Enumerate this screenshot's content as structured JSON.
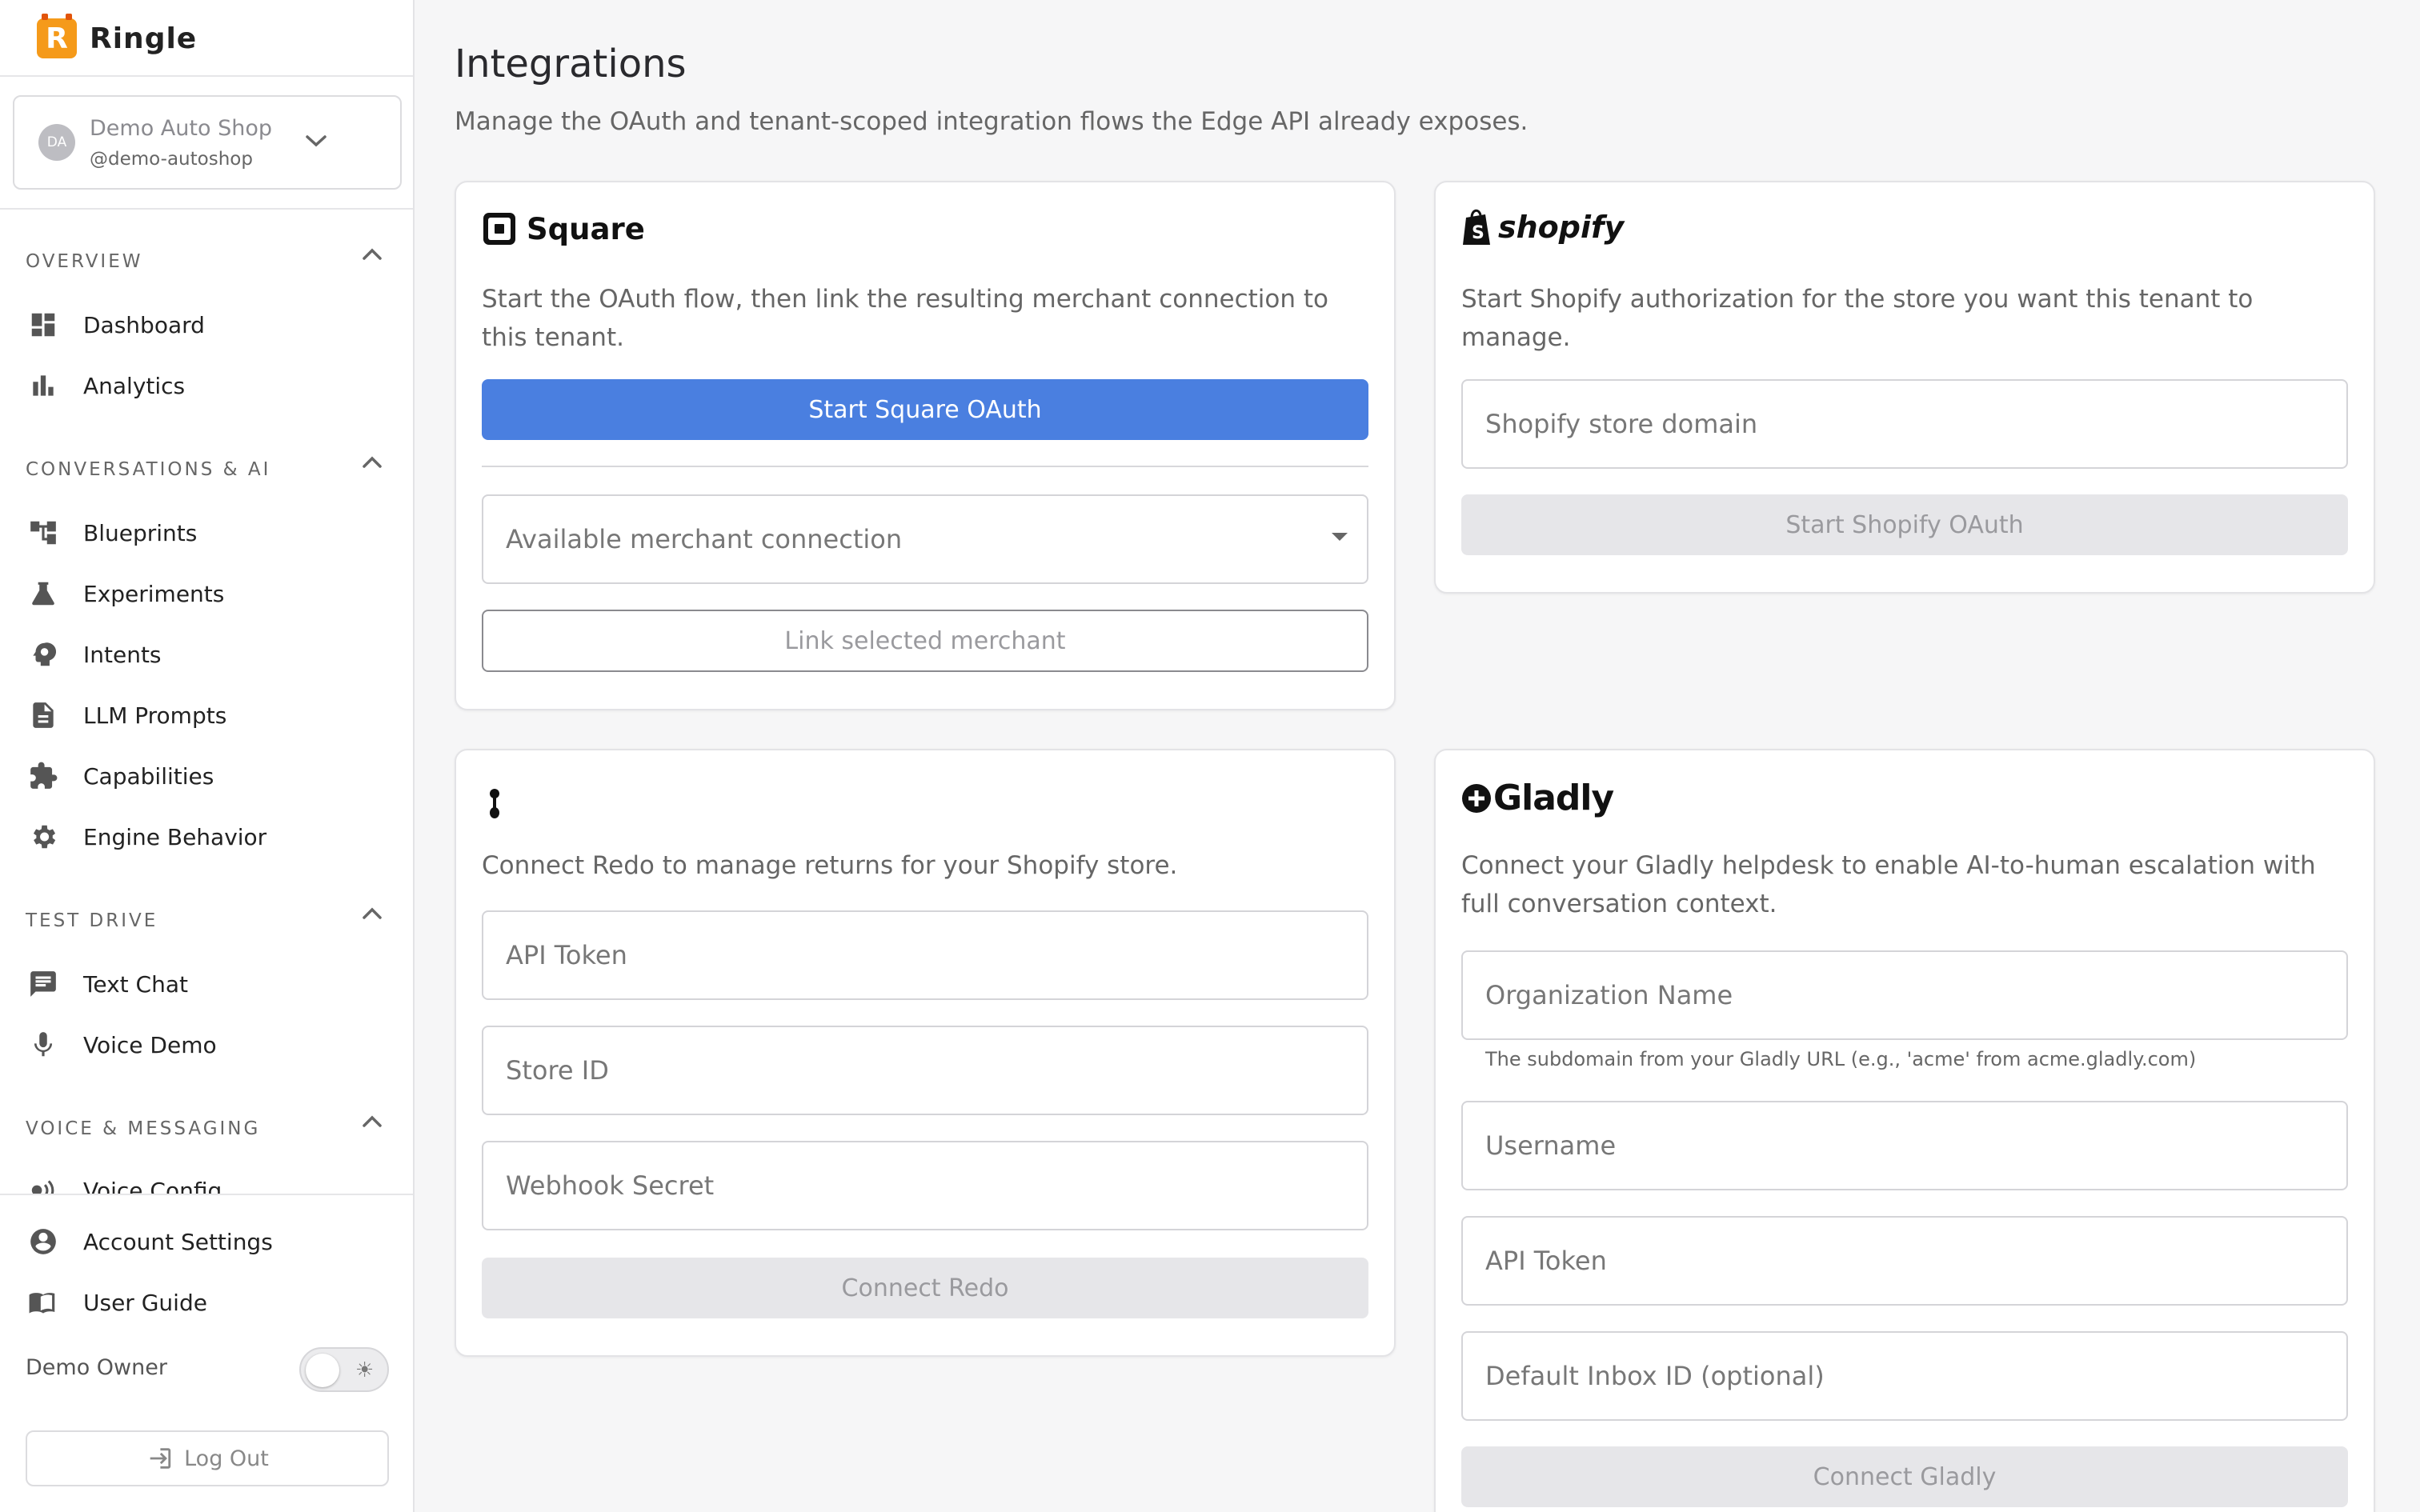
{
  "brand": {
    "name": "Ringle",
    "logo_letter": "R",
    "accent": "#f59a1a"
  },
  "tenant": {
    "initials": "DA",
    "name": "Demo Auto Shop",
    "handle": "@demo-autoshop"
  },
  "sidebar": {
    "sections": [
      {
        "title": "OVERVIEW",
        "items": [
          {
            "label": "Dashboard",
            "icon": "dashboard-icon"
          },
          {
            "label": "Analytics",
            "icon": "bar-chart-icon"
          }
        ]
      },
      {
        "title": "CONVERSATIONS & AI",
        "items": [
          {
            "label": "Blueprints",
            "icon": "tree-icon"
          },
          {
            "label": "Experiments",
            "icon": "flask-icon"
          },
          {
            "label": "Intents",
            "icon": "brain-icon"
          },
          {
            "label": "LLM Prompts",
            "icon": "document-icon"
          },
          {
            "label": "Capabilities",
            "icon": "puzzle-icon"
          },
          {
            "label": "Engine Behavior",
            "icon": "gear-icon"
          }
        ]
      },
      {
        "title": "TEST DRIVE",
        "items": [
          {
            "label": "Text Chat",
            "icon": "chat-icon"
          },
          {
            "label": "Voice Demo",
            "icon": "microphone-icon"
          }
        ]
      },
      {
        "title": "VOICE & MESSAGING",
        "items": [
          {
            "label": "Voice Config",
            "icon": "voice-icon"
          }
        ]
      }
    ],
    "bottom": [
      {
        "label": "Account Settings",
        "icon": "account-icon"
      },
      {
        "label": "User Guide",
        "icon": "book-icon"
      }
    ],
    "owner_label": "Demo Owner",
    "logout_label": "Log Out"
  },
  "main": {
    "title": "Integrations",
    "subtitle": "Manage the OAuth and tenant-scoped integration flows the Edge API already exposes."
  },
  "square": {
    "name": "Square",
    "description": "Start the OAuth flow, then link the resulting merchant connection to this tenant.",
    "start_button": "Start Square OAuth",
    "select_placeholder": "Available merchant connection",
    "link_button": "Link selected merchant",
    "button_color": "#4a7fe0"
  },
  "shopify": {
    "name": "shopify",
    "description": "Start Shopify authorization for the store you want this tenant to manage.",
    "domain_placeholder": "Shopify store domain",
    "start_button": "Start Shopify OAuth"
  },
  "redo": {
    "description": "Connect Redo to manage returns for your Shopify store.",
    "api_token_placeholder": "API Token",
    "store_id_placeholder": "Store ID",
    "webhook_placeholder": "Webhook Secret",
    "connect_button": "Connect Redo"
  },
  "gladly": {
    "name": "Gladly",
    "description": "Connect your Gladly helpdesk to enable AI-to-human escalation with full conversation context.",
    "org_placeholder": "Organization Name",
    "org_helper": "The subdomain from your Gladly URL (e.g., 'acme' from acme.gladly.com)",
    "username_placeholder": "Username",
    "api_token_placeholder": "API Token",
    "inbox_placeholder": "Default Inbox ID (optional)",
    "connect_button": "Connect Gladly"
  }
}
